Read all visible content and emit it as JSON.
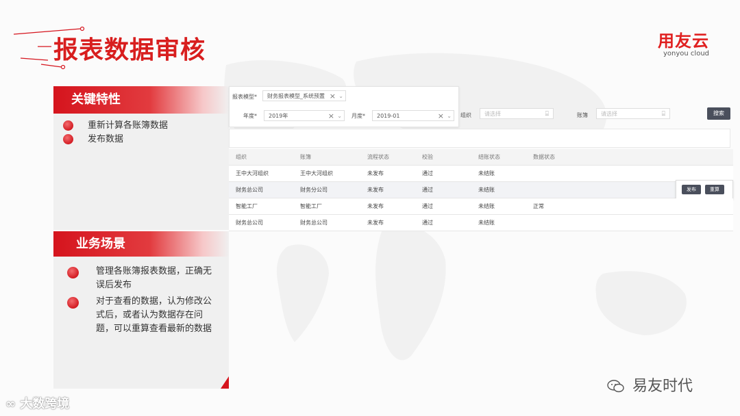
{
  "page": {
    "title": "报表数据审核"
  },
  "brand": {
    "name": "用友云",
    "tagline": "yonyou cloud"
  },
  "features": {
    "heading": "关键特性",
    "items": [
      "重新计算各账簿数据",
      "发布数据"
    ]
  },
  "scenarios": {
    "heading": "业务场景",
    "items": [
      "管理各账簿报表数据，正确无误后发布",
      "对于查看的数据，认为修改公式后，或者认为数据存在问题，可以重算查看最新的数据"
    ]
  },
  "query": {
    "report_type_label": "报表模型*",
    "report_type_value": "财务报表模型_系统预置",
    "year_label": "年度*",
    "year_value": "2019年",
    "month_label": "月度*",
    "month_value": "2019-01",
    "org_label": "组织",
    "org_placeholder": "请选择",
    "book_label": "账簿",
    "book_placeholder": "请选择",
    "search_button": "搜索"
  },
  "table": {
    "columns": [
      "组织",
      "账簿",
      "流程状态",
      "校验",
      "结账状态",
      "数据状态"
    ],
    "rows": [
      [
        "王中大河组织",
        "王中大河组织",
        "未发布",
        "通过",
        "未结账",
        ""
      ],
      [
        "财务总公司",
        "财务分公司",
        "未发布",
        "通过",
        "未结账",
        ""
      ],
      [
        "智能工厂",
        "智能工厂",
        "未发布",
        "通过",
        "未结账",
        "正常"
      ],
      [
        "财务总公司",
        "财务总公司",
        "未发布",
        "通过",
        "未结账",
        ""
      ]
    ],
    "actions": {
      "publish": "发布",
      "recalc": "重算"
    }
  },
  "watermarks": {
    "left": "大数跨境",
    "right": "易友时代"
  },
  "colors": {
    "accent": "#d5141d",
    "button": "#4a4f5c"
  }
}
